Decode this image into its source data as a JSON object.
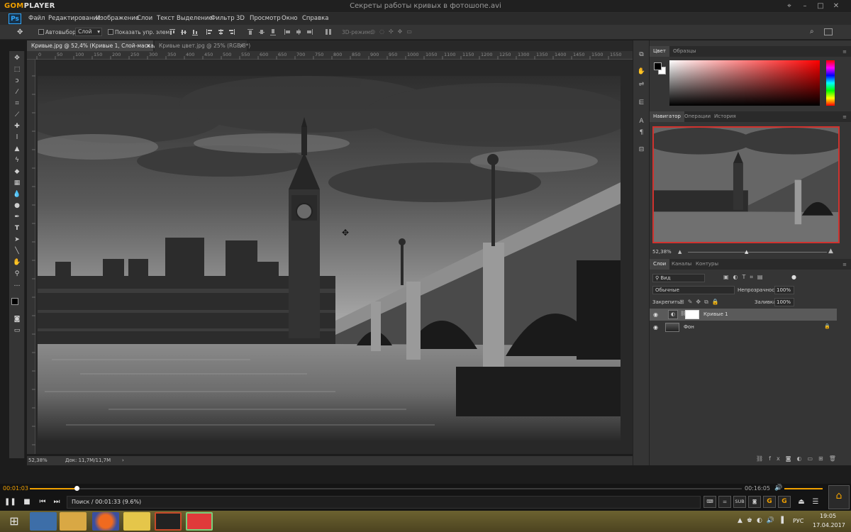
{
  "gom": {
    "logo_a": "GOM",
    "logo_b": "PLAYER",
    "file_title": "Секреты работы кривых в фотошопе.avi",
    "window_buttons": [
      "pin-icon",
      "minimize-icon",
      "maximize-icon",
      "close-icon"
    ]
  },
  "photoshop": {
    "logo": "Ps",
    "menu": [
      "Файл",
      "Редактирование",
      "Изображение",
      "Слои",
      "Текст",
      "Выделение",
      "Фильтр",
      "3D",
      "Просмотр",
      "Окно",
      "Справка"
    ],
    "options": {
      "autoselect_label": "Автовыбор:",
      "autoselect_value": "Слой",
      "show_controls_label": "Показать упр. элем.",
      "mode_3d_label": "3D-режим:"
    },
    "tabs": [
      {
        "label": "Кривые.jpg @ 52,4% (Кривые 1, Слой-маска/8) *",
        "active": true
      },
      {
        "label": "Кривые цвет.jpg @ 25% (RGB/8*)",
        "active": false
      }
    ],
    "ruler_numbers": [
      "0",
      "50",
      "100",
      "150",
      "200",
      "250",
      "300",
      "350",
      "400",
      "450",
      "500",
      "550",
      "600",
      "650",
      "700",
      "750",
      "800",
      "850",
      "900",
      "950",
      "1000",
      "1050",
      "1100",
      "1150",
      "1200",
      "1250",
      "1300",
      "1350",
      "1400",
      "1450",
      "1500",
      "1550"
    ],
    "status": {
      "zoom": "52,38%",
      "doc": "Док: 11,7M/11,7M"
    },
    "panels": {
      "color_tabs": [
        "Цвет",
        "Образцы"
      ],
      "nav_tabs": [
        "Навигатор",
        "Операции",
        "История"
      ],
      "nav_zoom": "52,38%",
      "layer_tabs": [
        "Слои",
        "Каналы",
        "Контуры"
      ],
      "filter_label": "Вид",
      "blend_mode": "Обычные",
      "opacity_label": "Непрозрачность:",
      "opacity_value": "100%",
      "lock_label": "Закрепить:",
      "fill_label": "Заливка:",
      "fill_value": "100%",
      "layers": [
        {
          "name": "Кривые 1",
          "selected": true
        },
        {
          "name": "Фон",
          "selected": false
        }
      ]
    }
  },
  "player": {
    "time_current": "00:01:03",
    "time_total": "00:16:05",
    "progress": 0.066,
    "status_text": "Поиск / 00:01:33 (9.6%)",
    "right_buttons": [
      "subtitle-icon",
      "equalizer-icon",
      "SUB",
      "capture-icon",
      "G",
      "G",
      "eject-icon",
      "menu-icon"
    ]
  },
  "taskbar": {
    "lang": "РУС",
    "time": "19:05",
    "date": "17.04.2017",
    "apps": [
      "monitor-app",
      "explorer-app",
      "firefox-app",
      "gom-app",
      "studio-app",
      "screen-recorder-app"
    ]
  }
}
